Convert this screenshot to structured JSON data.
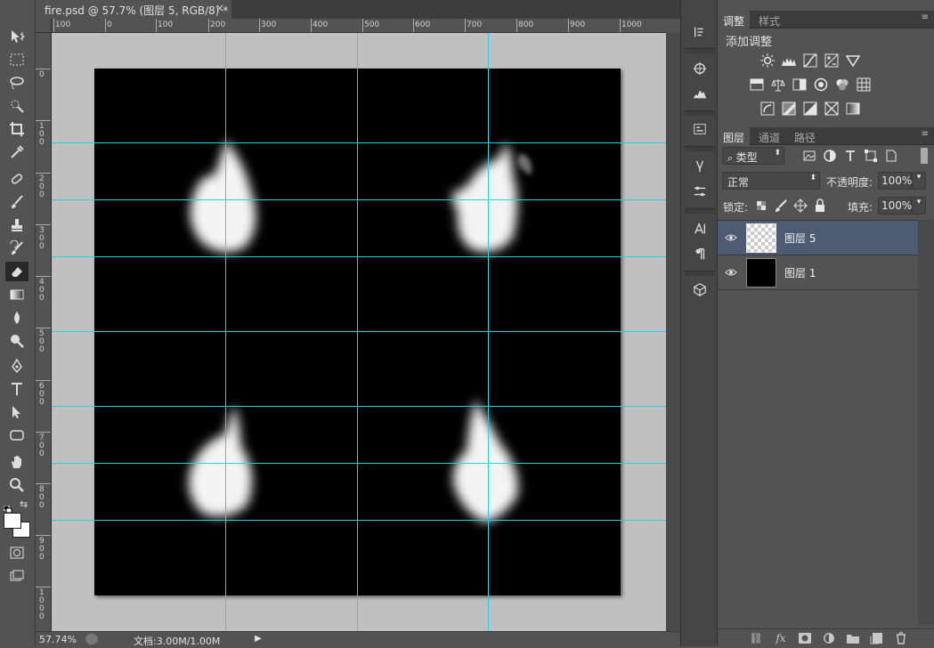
{
  "document": {
    "tab_title": "fire.psd @ 57.7% (图层 5, RGB/8) *",
    "close_glyph": "×"
  },
  "rulers": {
    "horizontal": [
      "100",
      "0",
      "100",
      "200",
      "300",
      "400",
      "500",
      "600",
      "700",
      "800",
      "900",
      "1000"
    ],
    "vertical": [
      [
        "0"
      ],
      [
        "1",
        "0",
        "0"
      ],
      [
        "2",
        "0",
        "0"
      ],
      [
        "3",
        "0",
        "0"
      ],
      [
        "4",
        "0",
        "0"
      ],
      [
        "5",
        "0",
        "0"
      ],
      [
        "6",
        "0",
        "0"
      ],
      [
        "7",
        "0",
        "0"
      ],
      [
        "8",
        "0",
        "0"
      ],
      [
        "9",
        "0",
        "0"
      ],
      [
        "1",
        "0",
        "0",
        "0"
      ]
    ]
  },
  "status": {
    "zoom": "57.74%",
    "doc_info": "文档:3.00M/1.00M",
    "arrow": "▶"
  },
  "adjustments": {
    "tabs": [
      "调整",
      "样式"
    ],
    "title": "添加调整"
  },
  "layers_panel": {
    "tabs": [
      "图层",
      "通道",
      "路径"
    ],
    "filter_kind": "类型",
    "blend_mode": "正常",
    "opacity_label": "不透明度:",
    "opacity_value": "100%",
    "lock_label": "锁定:",
    "fill_label": "填充:",
    "fill_value": "100%",
    "layers": [
      {
        "name": "图层 5",
        "selected": true,
        "thumb": "transparent"
      },
      {
        "name": "图层 1",
        "selected": false,
        "thumb": "black"
      }
    ]
  },
  "colors": {
    "guide": "#22d4e0",
    "selected_layer": "#4d5b73",
    "canvas": "#000000",
    "pasteboard": "#c0c0c0"
  }
}
